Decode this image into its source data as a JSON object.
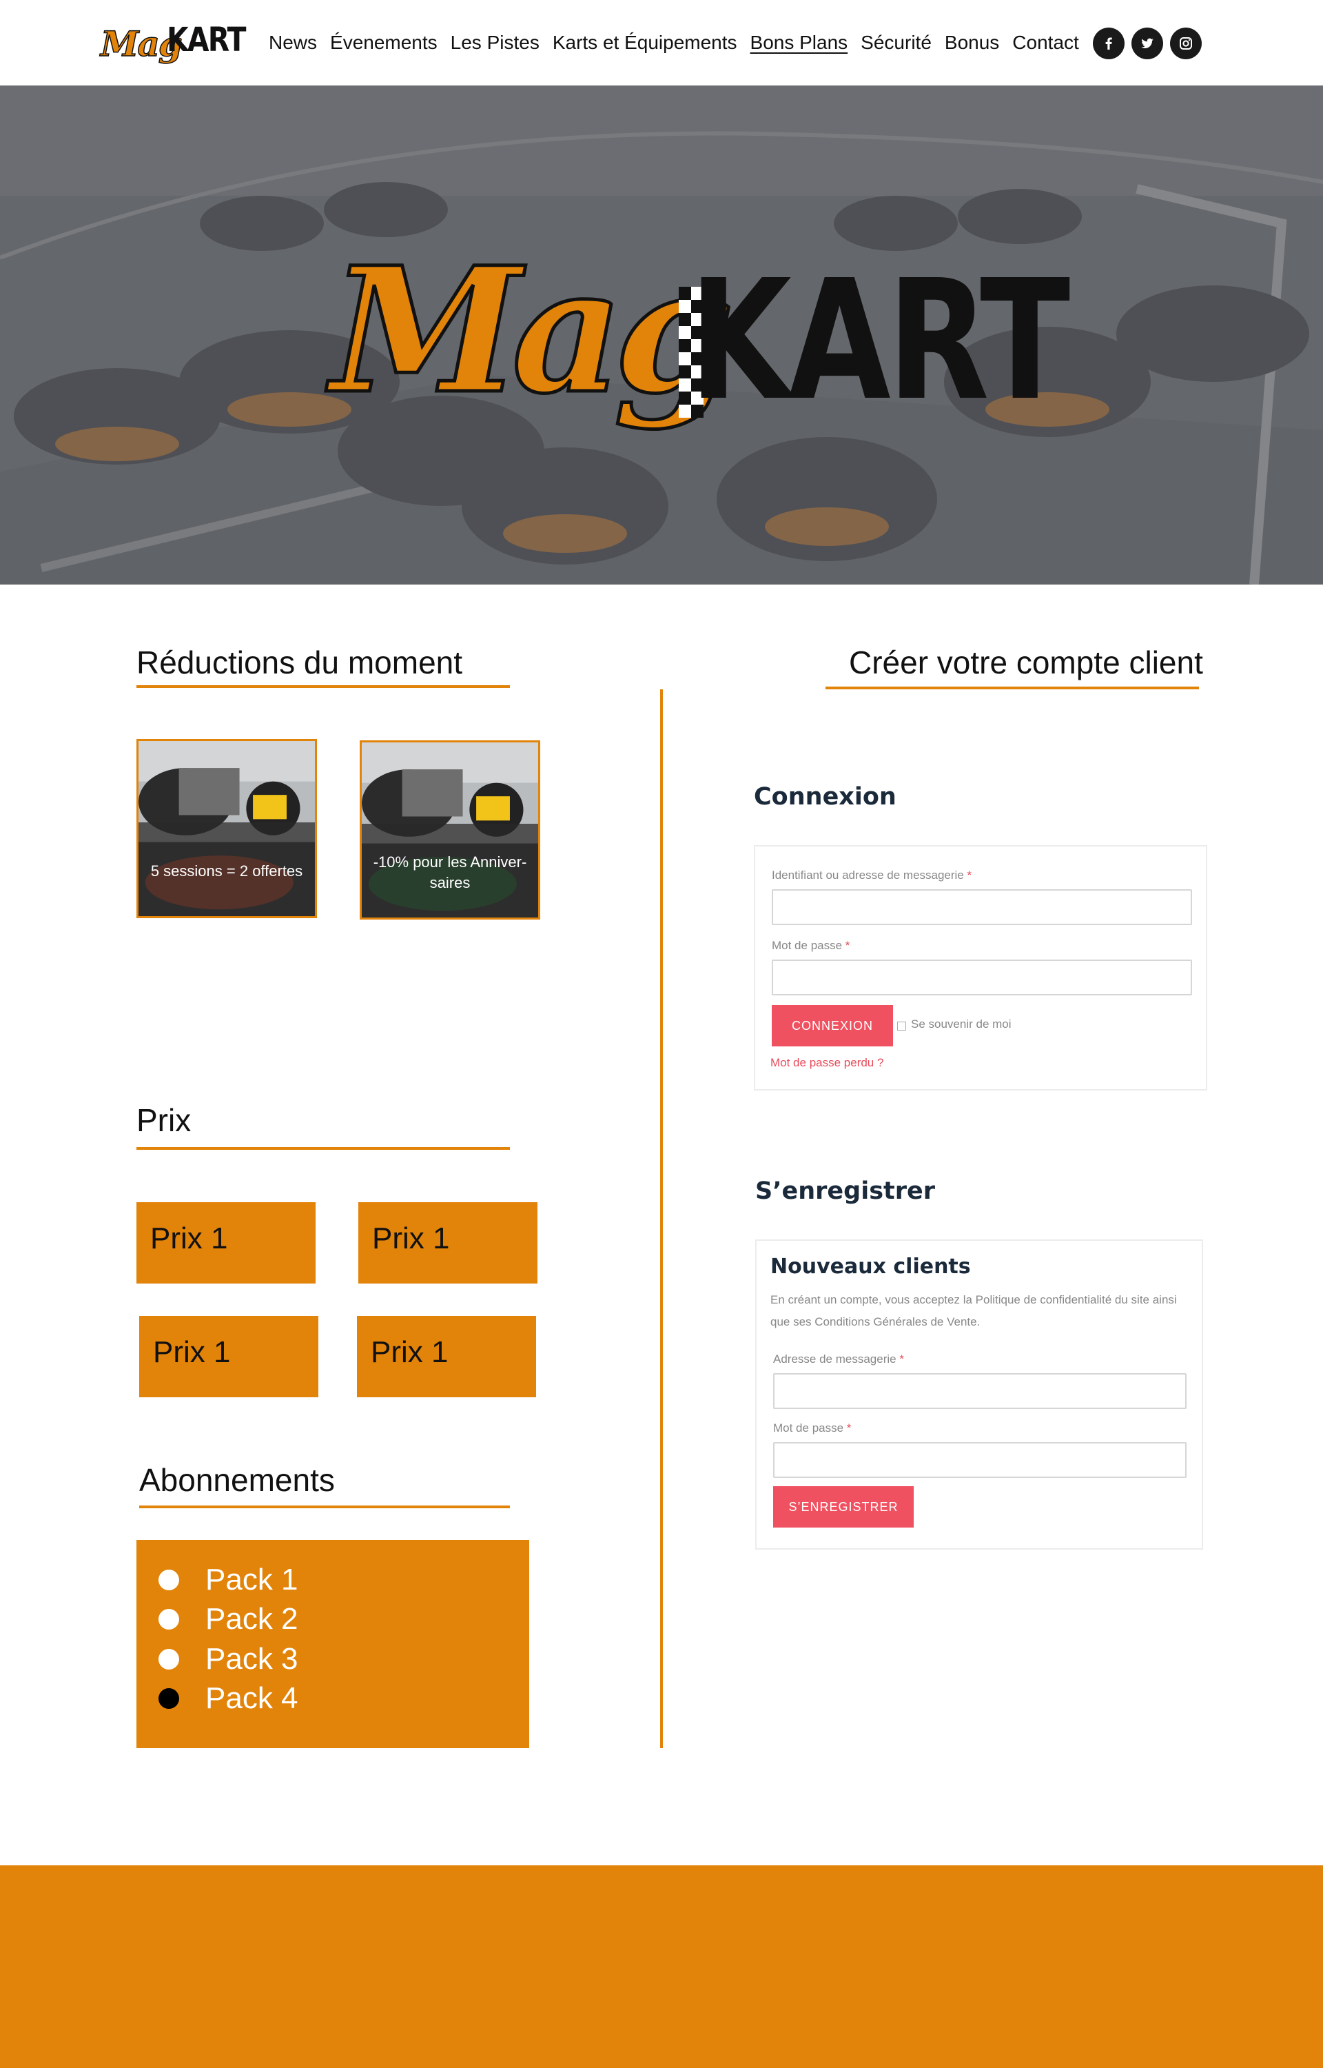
{
  "brand": {
    "logo_script": "Mag",
    "logo_block": "KART"
  },
  "nav": {
    "items": [
      {
        "label": "News",
        "active": false
      },
      {
        "label": "Évenements",
        "active": false
      },
      {
        "label": "Les Pistes",
        "active": false
      },
      {
        "label": "Karts et Équipements",
        "active": false
      },
      {
        "label": "Bons Plans",
        "active": true
      },
      {
        "label": "Sécurité",
        "active": false
      },
      {
        "label": "Bonus",
        "active": false
      },
      {
        "label": "Contact",
        "active": false
      }
    ]
  },
  "social": {
    "icons": [
      "facebook-icon",
      "twitter-icon",
      "instagram-icon"
    ]
  },
  "hero": {
    "logo_script": "Mag",
    "logo_block": "KART"
  },
  "deals": {
    "title": "Réductions du moment",
    "items": [
      {
        "label": "5 sessions = 2 offertes"
      },
      {
        "label": "-10% pour les Anniver-saires"
      }
    ]
  },
  "prices": {
    "title": "Prix",
    "items": [
      "Prix 1",
      "Prix 1",
      "Prix 1",
      "Prix 1"
    ]
  },
  "subscriptions": {
    "title": "Abonnements",
    "items": [
      "Pack 1",
      "Pack 2",
      "Pack 3",
      "Pack 4"
    ]
  },
  "account": {
    "title": "Créer votre compte client"
  },
  "login": {
    "title": "Connexion",
    "username_label": "Identifiant ou adresse de messagerie",
    "password_label": "Mot de passe",
    "required_mark": "*",
    "submit_label": "CONNEXION",
    "remember_label": "Se souvenir de moi",
    "lost_password": "Mot de passe perdu ?"
  },
  "register": {
    "title": "S’enregistrer",
    "card_title": "Nouveaux clients",
    "description": "En créant un compte, vous acceptez la Politique de confidentialité du site ainsi que ses Conditions Générales de Vente.",
    "email_label": "Adresse de messagerie",
    "password_label": "Mot de passe",
    "required_mark": "*",
    "submit_label": "S’ENREGISTRER"
  },
  "colors": {
    "accent": "#e2830a",
    "button": "#f05161",
    "heading_dark": "#1b2a3a"
  }
}
